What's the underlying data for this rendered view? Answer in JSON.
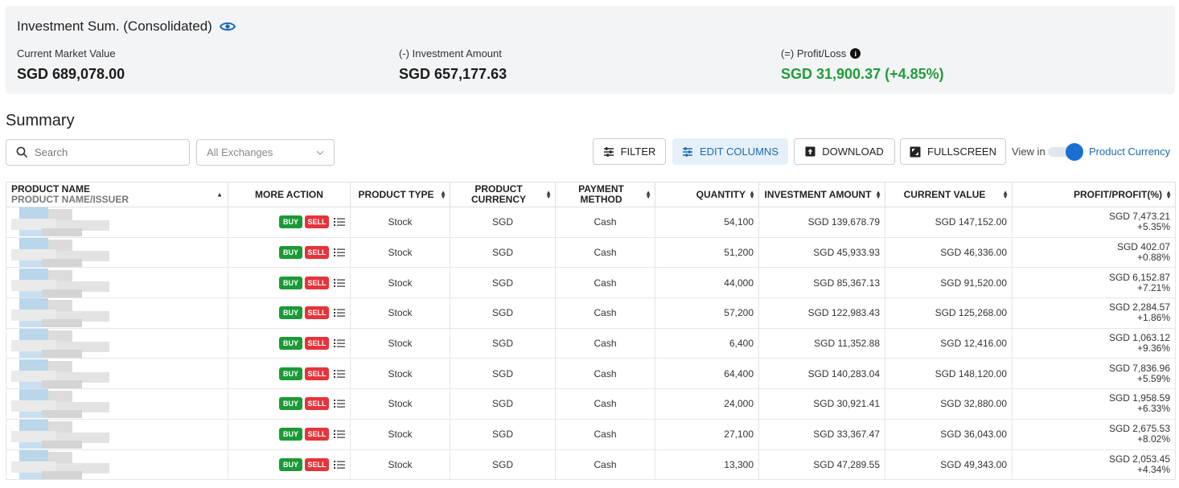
{
  "summary_card": {
    "title": "Investment Sum. (Consolidated)",
    "metrics": [
      {
        "label": "Current Market Value",
        "value": "SGD 689,078.00"
      },
      {
        "label": "(-) Investment Amount",
        "value": "SGD 657,177.63"
      },
      {
        "label": "(=) Profit/Loss",
        "value": "SGD 31,900.37 (+4.85%)"
      }
    ]
  },
  "section_title": "Summary",
  "toolbar": {
    "search_placeholder": "Search",
    "exchange_select": "All Exchanges",
    "filter_label": "FILTER",
    "edit_columns_label": "EDIT COLUMNS",
    "download_label": "DOWNLOAD",
    "fullscreen_label": "FULLSCREEN",
    "view_in_label": "View in",
    "currency_toggle_label": "Product Currency"
  },
  "colors": {
    "buy": "#1a9a36",
    "sell": "#e5343b",
    "profit": "#1f9d3a",
    "accent": "#1a6fd1"
  },
  "table": {
    "headers": {
      "product_name": "PRODUCT NAME",
      "product_name_sub": "PRODUCT NAME/ISSUER",
      "more_action": "MORE ACTION",
      "product_type": "PRODUCT TYPE",
      "product_currency_1": "PRODUCT",
      "product_currency_2": "CURRENCY",
      "payment_method_1": "PAYMENT",
      "payment_method_2": "METHOD",
      "quantity": "QUANTITY",
      "investment_amount": "INVESTMENT AMOUNT",
      "current_value": "CURRENT VALUE",
      "profit": "PROFIT/PROFIT(%)"
    },
    "buy_label": "BUY",
    "sell_label": "SELL",
    "rows": [
      {
        "type": "Stock",
        "currency": "SGD",
        "payment": "Cash",
        "quantity": "54,100",
        "investment": "SGD 139,678.79",
        "current": "SGD 147,152.00",
        "profit": "SGD 7,473.21",
        "profit_pct": "+5.35%"
      },
      {
        "type": "Stock",
        "currency": "SGD",
        "payment": "Cash",
        "quantity": "51,200",
        "investment": "SGD 45,933.93",
        "current": "SGD 46,336.00",
        "profit": "SGD 402.07",
        "profit_pct": "+0.88%"
      },
      {
        "type": "Stock",
        "currency": "SGD",
        "payment": "Cash",
        "quantity": "44,000",
        "investment": "SGD 85,367.13",
        "current": "SGD 91,520.00",
        "profit": "SGD 6,152.87",
        "profit_pct": "+7.21%"
      },
      {
        "type": "Stock",
        "currency": "SGD",
        "payment": "Cash",
        "quantity": "57,200",
        "investment": "SGD 122,983.43",
        "current": "SGD 125,268.00",
        "profit": "SGD 2,284.57",
        "profit_pct": "+1.86%"
      },
      {
        "type": "Stock",
        "currency": "SGD",
        "payment": "Cash",
        "quantity": "6,400",
        "investment": "SGD 11,352.88",
        "current": "SGD 12,416.00",
        "profit": "SGD 1,063.12",
        "profit_pct": "+9.36%"
      },
      {
        "type": "Stock",
        "currency": "SGD",
        "payment": "Cash",
        "quantity": "64,400",
        "investment": "SGD 140,283.04",
        "current": "SGD 148,120.00",
        "profit": "SGD 7,836.96",
        "profit_pct": "+5.59%"
      },
      {
        "type": "Stock",
        "currency": "SGD",
        "payment": "Cash",
        "quantity": "24,000",
        "investment": "SGD 30,921.41",
        "current": "SGD 32,880.00",
        "profit": "SGD 1,958.59",
        "profit_pct": "+6.33%"
      },
      {
        "type": "Stock",
        "currency": "SGD",
        "payment": "Cash",
        "quantity": "27,100",
        "investment": "SGD 33,367.47",
        "current": "SGD 36,043.00",
        "profit": "SGD 2,675.53",
        "profit_pct": "+8.02%"
      },
      {
        "type": "Stock",
        "currency": "SGD",
        "payment": "Cash",
        "quantity": "13,300",
        "investment": "SGD 47,289.55",
        "current": "SGD 49,343.00",
        "profit": "SGD 2,053.45",
        "profit_pct": "+4.34%"
      }
    ]
  }
}
